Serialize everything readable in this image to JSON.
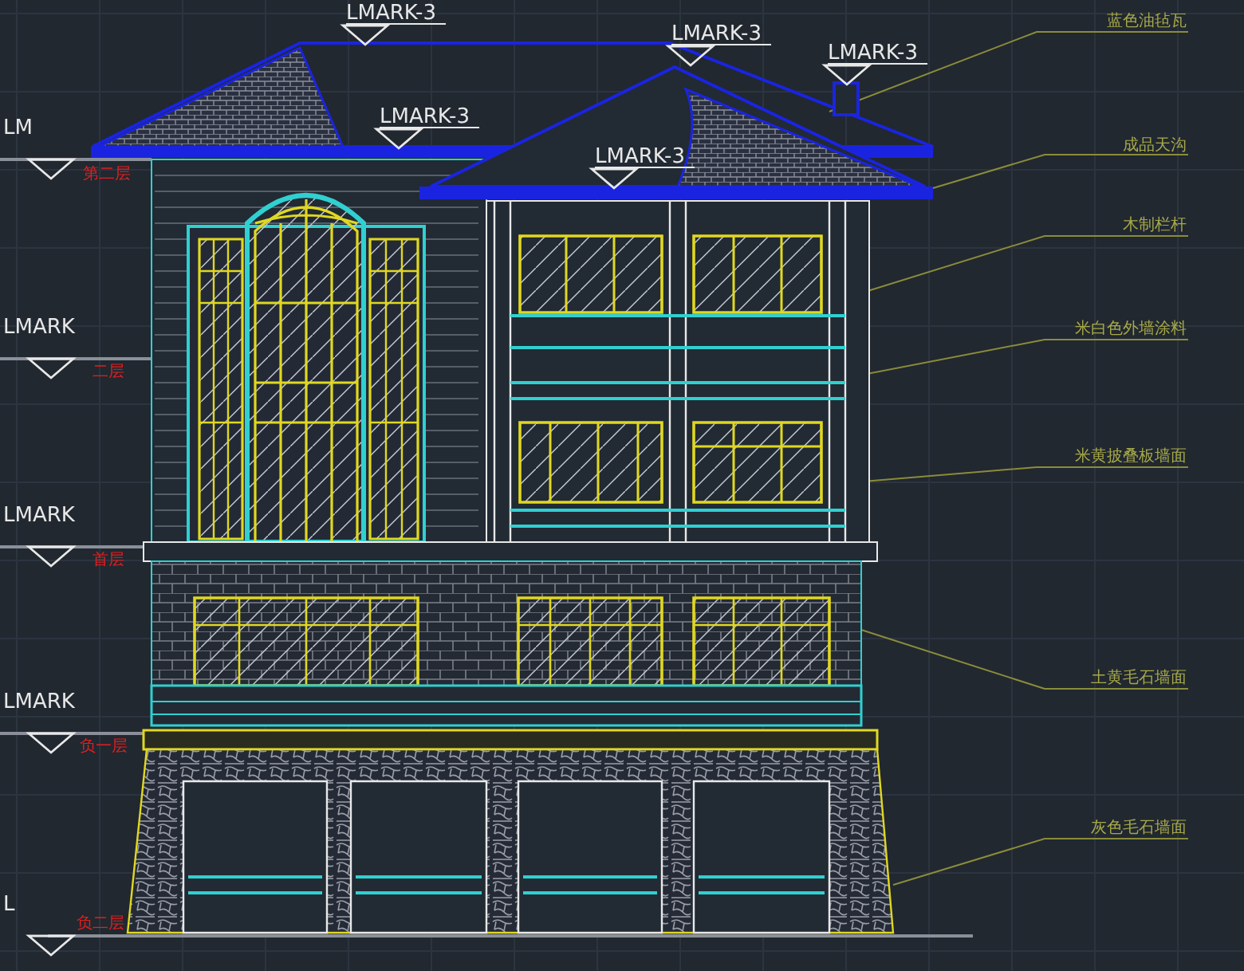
{
  "top_level_marks": [
    {
      "text": "LMARK-3"
    },
    {
      "text": "LMARK-3"
    },
    {
      "text": "LMARK-3"
    },
    {
      "text": "LMARK-3"
    },
    {
      "text": "LMARK-3"
    }
  ],
  "side_level_marks": [
    {
      "text": "LM",
      "floor": "第二层"
    },
    {
      "text": "LMARK",
      "floor": "二层"
    },
    {
      "text": "LMARK",
      "floor": "首层"
    },
    {
      "text": "LMARK",
      "floor": "负一层"
    },
    {
      "text": "L",
      "floor": "负二层"
    }
  ],
  "annotations": [
    {
      "text": "蓝色油毡瓦"
    },
    {
      "text": "成品天沟"
    },
    {
      "text": "木制栏杆"
    },
    {
      "text": "米白色外墙涂料"
    },
    {
      "text": "米黄披叠板墙面"
    },
    {
      "text": "土黄毛石墙面"
    },
    {
      "text": "灰色毛石墙面"
    }
  ]
}
